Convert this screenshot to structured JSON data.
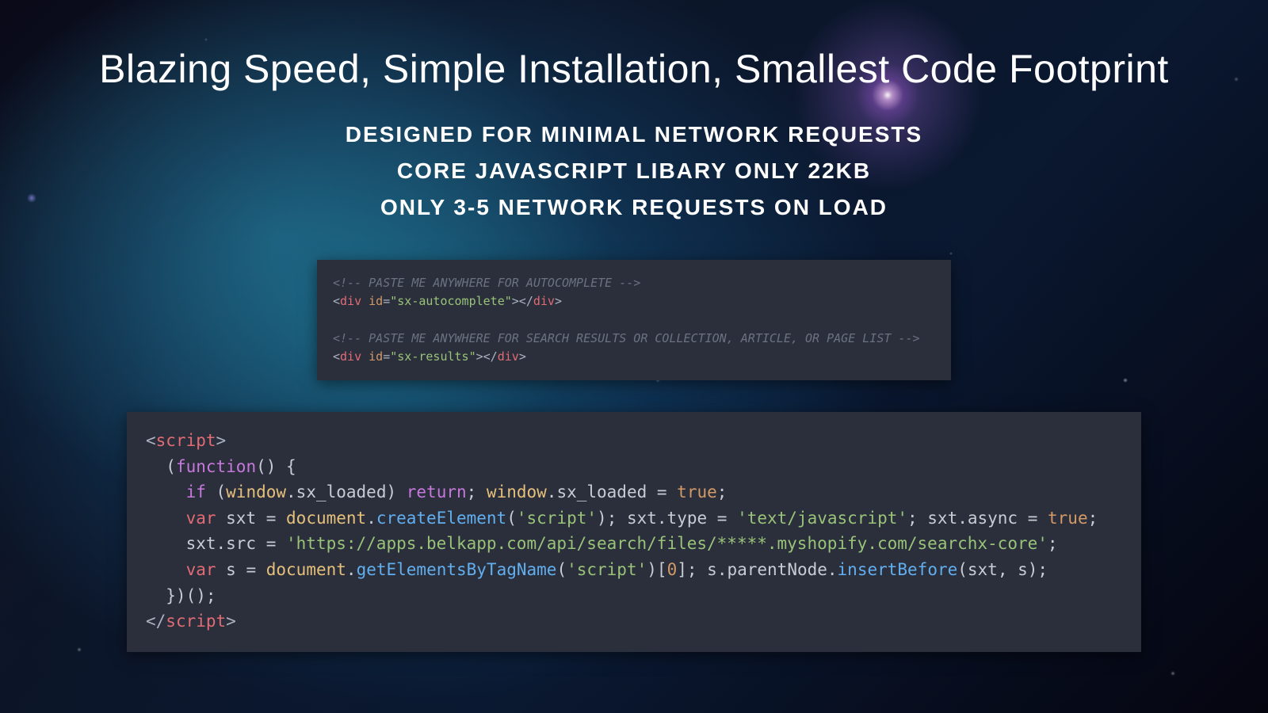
{
  "title": "Blazing Speed, Simple Installation, Smallest Code Footprint",
  "sub1": "DESIGNED FOR MINIMAL NETWORK REQUESTS",
  "sub2": "CORE JAVASCRIPT LIBARY ONLY 22KB",
  "sub3": "ONLY 3-5 NETWORK REQUESTS ON LOAD",
  "code1": {
    "c1": "<!-- PASTE ME ANYWHERE FOR AUTOCOMPLETE -->",
    "l2_open": "<div",
    "l2_attr": " id",
    "l2_eq": "=",
    "l2_val": "\"sx-autocomplete\"",
    "l2_close1": ">",
    "l2_close2": "</div>",
    "c2": "<!-- PASTE ME ANYWHERE FOR SEARCH RESULTS OR COLLECTION, ARTICLE, OR PAGE LIST -->",
    "l4_open": "<div",
    "l4_attr": " id",
    "l4_eq": "=",
    "l4_val": "\"sx-results\"",
    "l4_close1": ">",
    "l4_close2": "</div>"
  },
  "code2": {
    "t_open": "<script>",
    "t_close": "</script>",
    "fn_open": "  (",
    "fn_kw": "function",
    "fn_paren": "() {",
    "if_kw": "    if",
    "if_cond_open": " (",
    "window": "window",
    "dot": ".",
    "sx_loaded": "sx_loaded",
    "if_cond_close": ") ",
    "return": "return",
    "semi": "; ",
    "assign_true": " = ",
    "true": "true",
    "var": "    var",
    "sxt": " sxt ",
    "eq": "= ",
    "document": "document",
    "createElement": "createElement",
    "paren_o": "(",
    "paren_c": ")",
    "str_script": "'script'",
    "type_assign": "; sxt.type = ",
    "str_textjs": "'text/javascript'",
    "async_assign": "; sxt.async = ",
    "src_prefix": "    sxt.src = ",
    "str_url": "'https://apps.belkapp.com/api/search/files/*****.myshopify.com/searchx-core'",
    "var2": "    var",
    "s_name": " s ",
    "getByTag": "getElementsByTagName",
    "idx": "[",
    "zero": "0",
    "idx_c": "]; ",
    "s": "s",
    "parentNode": ".parentNode.",
    "insertBefore": "insertBefore",
    "args": "(sxt, s);",
    "close_fn": "  })();"
  }
}
